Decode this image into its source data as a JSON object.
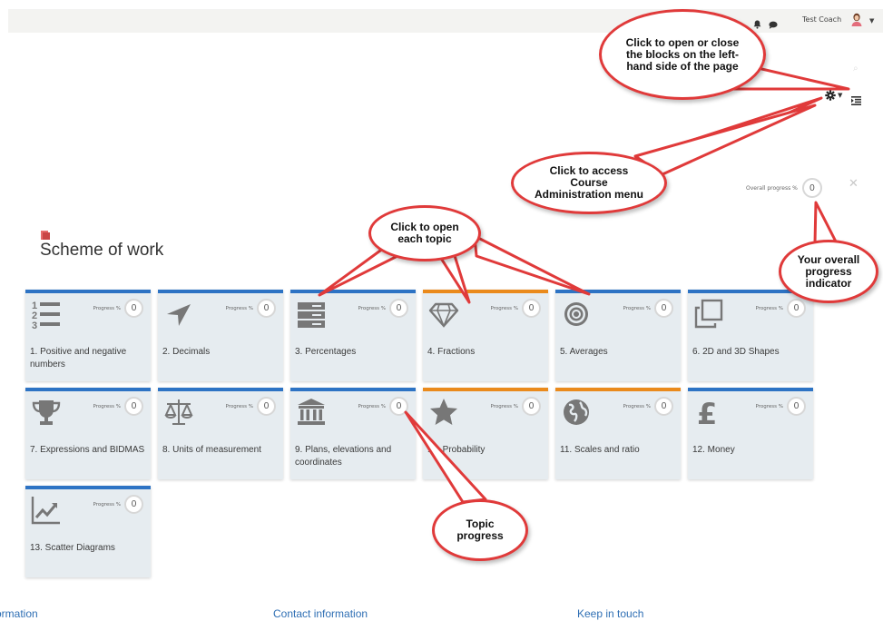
{
  "header": {
    "user_name": "Test Coach",
    "icons": [
      "bell-icon",
      "chat-icon",
      "avatar",
      "chevron-down-icon"
    ]
  },
  "course": {
    "title": "Scheme of work",
    "overall_label": "Overall progress %",
    "overall_value": "0"
  },
  "topics": [
    {
      "name": "1. Positive and negative numbers",
      "icon": "numbered-list-icon",
      "progress_label": "Progress %",
      "progress": "0",
      "accent": "blue"
    },
    {
      "name": "2. Decimals",
      "icon": "location-arrow-icon",
      "progress_label": "Progress %",
      "progress": "0",
      "accent": "blue"
    },
    {
      "name": "3. Percentages",
      "icon": "server-icon",
      "progress_label": "Progress %",
      "progress": "0",
      "accent": "blue"
    },
    {
      "name": "4. Fractions",
      "icon": "diamond-icon",
      "progress_label": "Progress %",
      "progress": "0",
      "accent": "orange"
    },
    {
      "name": "5. Averages",
      "icon": "target-icon",
      "progress_label": "Progress %",
      "progress": "0",
      "accent": "blue"
    },
    {
      "name": "6. 2D and 3D Shapes",
      "icon": "clone-icon",
      "progress_label": "Progress %",
      "progress": "0",
      "accent": "blue"
    },
    {
      "name": "7. Expressions and BIDMAS",
      "icon": "trophy-icon",
      "progress_label": "Progress %",
      "progress": "0",
      "accent": "blue"
    },
    {
      "name": "8. Units of measurement",
      "icon": "balance-scale-icon",
      "progress_label": "Progress %",
      "progress": "0",
      "accent": "blue"
    },
    {
      "name": "9. Plans, elevations and coordinates",
      "icon": "institution-icon",
      "progress_label": "Progress %",
      "progress": "0",
      "accent": "blue"
    },
    {
      "name": "10. Probability",
      "icon": "star-icon",
      "progress_label": "Progress %",
      "progress": "0",
      "accent": "orange"
    },
    {
      "name": "11. Scales and ratio",
      "icon": "globe-icon",
      "progress_label": "Progress %",
      "progress": "0",
      "accent": "orange"
    },
    {
      "name": "12. Money",
      "icon": "pound-sign-icon",
      "progress_label": "Progress %",
      "progress": "0",
      "accent": "blue"
    },
    {
      "name": "13. Scatter Diagrams",
      "icon": "line-chart-icon",
      "progress_label": "Progress %",
      "progress": "0",
      "accent": "blue"
    }
  ],
  "footer": {
    "col1": "ormation",
    "col2": "Contact information",
    "col3": "Keep in touch"
  },
  "callouts": {
    "blocks": "Click to open or close the blocks on the left-hand side of the page",
    "admin": "Click to access Course Administration menu",
    "open_topic": "Click to open each topic",
    "overall": "Your overall progress indicator",
    "topic_progress": "Topic progress"
  },
  "colors": {
    "accent_blue": "#2d73c4",
    "accent_orange": "#ea8a1c",
    "tile_bg": "#e6ecf0",
    "icon_grey": "#777777",
    "callout_border": "#e03a3a",
    "link_blue": "#2f6fb4"
  }
}
